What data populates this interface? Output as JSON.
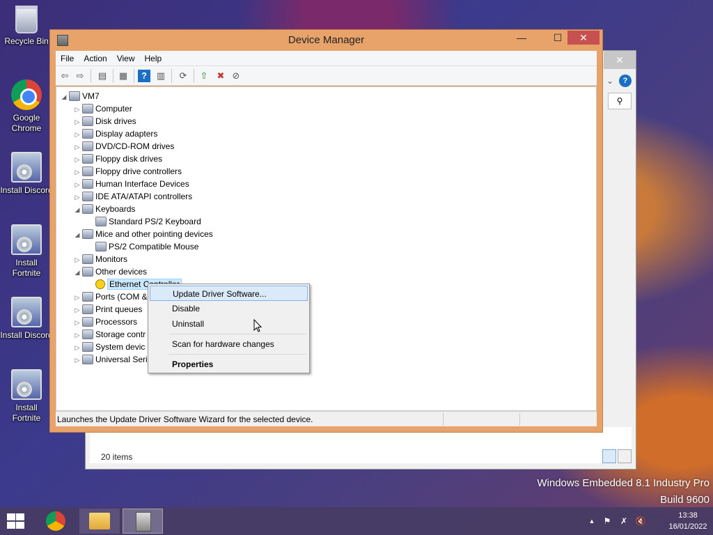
{
  "desktop": {
    "icons": [
      {
        "label": "Recycle Bin",
        "icon": "recycle-bin-icon"
      },
      {
        "label": "Google Chrome",
        "icon": "chrome-icon"
      },
      {
        "label": "Install Discord",
        "icon": "installer-icon"
      },
      {
        "label": "Install Fortnite",
        "icon": "installer-icon"
      },
      {
        "label": "Install Discord",
        "icon": "installer-icon"
      },
      {
        "label": "Install Fortnite",
        "icon": "installer-icon"
      }
    ],
    "watermark": {
      "line1": "Windows Embedded 8.1 Industry Pro",
      "line2": "Build 9600"
    }
  },
  "bg_window": {
    "status": "20 items",
    "close_glyph": "✕",
    "help_glyph": "?",
    "chevron_glyph": "⌄",
    "search_glyph": "⚲"
  },
  "device_manager": {
    "title": "Device Manager",
    "window_buttons": {
      "minimize": "—",
      "maximize": "☐",
      "close": "✕"
    },
    "menu": [
      "File",
      "Action",
      "View",
      "Help"
    ],
    "toolbar_glyphs": {
      "back": "⇦",
      "forward": "⇨",
      "properties": "▤",
      "show_hidden": "▦",
      "help": "?",
      "view": "▥",
      "scan": "⟳",
      "update": "⇧",
      "uninstall": "✖",
      "disable": "⊘"
    },
    "tree": [
      {
        "label": "VM7",
        "level": 0,
        "state": "expanded"
      },
      {
        "label": "Computer",
        "level": 1,
        "state": "collapsed"
      },
      {
        "label": "Disk drives",
        "level": 1,
        "state": "collapsed"
      },
      {
        "label": "Display adapters",
        "level": 1,
        "state": "collapsed"
      },
      {
        "label": "DVD/CD-ROM drives",
        "level": 1,
        "state": "collapsed"
      },
      {
        "label": "Floppy disk drives",
        "level": 1,
        "state": "collapsed"
      },
      {
        "label": "Floppy drive controllers",
        "level": 1,
        "state": "collapsed"
      },
      {
        "label": "Human Interface Devices",
        "level": 1,
        "state": "collapsed"
      },
      {
        "label": "IDE ATA/ATAPI controllers",
        "level": 1,
        "state": "collapsed"
      },
      {
        "label": "Keyboards",
        "level": 1,
        "state": "expanded"
      },
      {
        "label": "Standard PS/2 Keyboard",
        "level": 2,
        "state": "leaf"
      },
      {
        "label": "Mice and other pointing devices",
        "level": 1,
        "state": "expanded"
      },
      {
        "label": "PS/2 Compatible Mouse",
        "level": 2,
        "state": "leaf"
      },
      {
        "label": "Monitors",
        "level": 1,
        "state": "collapsed"
      },
      {
        "label": "Other devices",
        "level": 1,
        "state": "expanded"
      },
      {
        "label": "Ethernet Controller",
        "level": 2,
        "state": "leaf",
        "selected": true,
        "warning": true
      },
      {
        "label": "Ports (COM &",
        "level": 1,
        "state": "collapsed"
      },
      {
        "label": "Print queues",
        "level": 1,
        "state": "collapsed"
      },
      {
        "label": "Processors",
        "level": 1,
        "state": "collapsed"
      },
      {
        "label": "Storage contr",
        "level": 1,
        "state": "collapsed"
      },
      {
        "label": "System devic",
        "level": 1,
        "state": "collapsed"
      },
      {
        "label": "Universal Seri",
        "level": 1,
        "state": "collapsed"
      }
    ],
    "status": "Launches the Update Driver Software Wizard for the selected device."
  },
  "context_menu": {
    "items": [
      {
        "label": "Update Driver Software...",
        "highlighted": true
      },
      {
        "label": "Disable"
      },
      {
        "label": "Uninstall"
      },
      {
        "label": "Scan for hardware changes"
      },
      {
        "label": "Properties",
        "bold": true
      }
    ]
  },
  "taskbar": {
    "apps": [
      {
        "name": "chrome",
        "icon": "chrome-icon"
      },
      {
        "name": "file-explorer",
        "icon": "folder-icon"
      },
      {
        "name": "device-manager",
        "icon": "device-manager-icon",
        "active": true
      }
    ],
    "tray_glyphs": {
      "expand": "▲",
      "flag": "⚑",
      "network": "✗",
      "volume": "🔇"
    },
    "clock": {
      "time": "13:38",
      "date": "16/01/2022"
    }
  },
  "colors": {
    "title_bar": "#e8a36a",
    "close_button": "#c75050",
    "selection": "#cce8ff",
    "menu_highlight": "#dbeaf9"
  }
}
